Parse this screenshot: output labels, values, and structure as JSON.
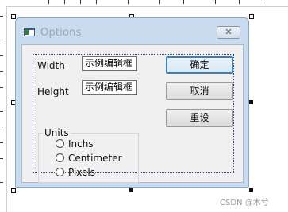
{
  "dialog": {
    "title": "Options",
    "close_glyph": "✕"
  },
  "form": {
    "width_label": "Width",
    "width_value": "示例编辑框",
    "height_label": "Height",
    "height_value": "示例编辑框"
  },
  "buttons": {
    "ok": "确定",
    "cancel": "取消",
    "reset": "重设"
  },
  "units": {
    "label": "Units",
    "options": [
      "Inchs",
      "Centimeter",
      "Pixels"
    ],
    "selected": null
  },
  "watermark": "CSDN @木兮"
}
